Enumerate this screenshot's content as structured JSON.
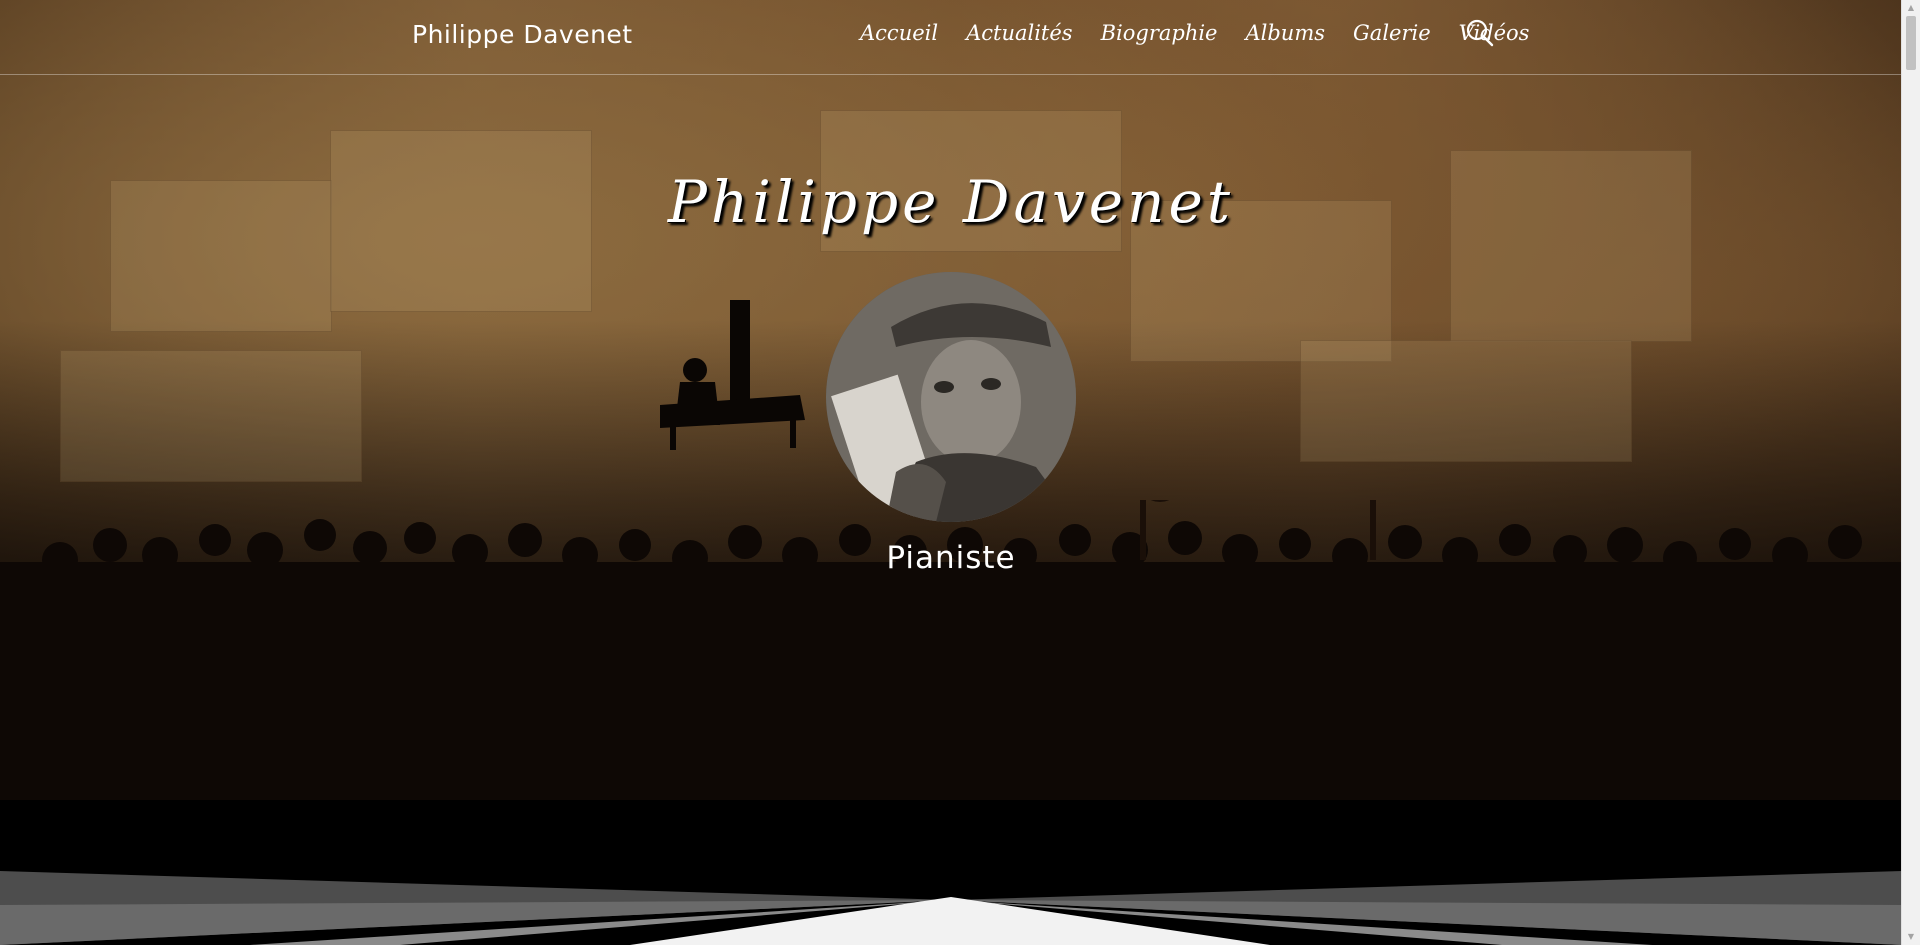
{
  "header": {
    "brand": "Philippe Davenet",
    "nav": [
      {
        "label": "Accueil",
        "id": "accueil"
      },
      {
        "label": "Actualités",
        "id": "actualites"
      },
      {
        "label": "Biographie",
        "id": "biographie"
      },
      {
        "label": "Albums",
        "id": "albums"
      },
      {
        "label": "Galerie",
        "id": "galerie"
      },
      {
        "label": "Vidéos",
        "id": "videos"
      }
    ],
    "search_icon": "search-icon"
  },
  "hero": {
    "title": "Philippe Davenet",
    "subtitle": "Pianiste",
    "avatar": "portrait-photo"
  },
  "colors": {
    "text": "#ffffff",
    "page_background": "#000000",
    "rays_light": "#f2f2f2",
    "rays_mid": "#8a8a8a",
    "rays_dark": "#4d4d4d"
  }
}
